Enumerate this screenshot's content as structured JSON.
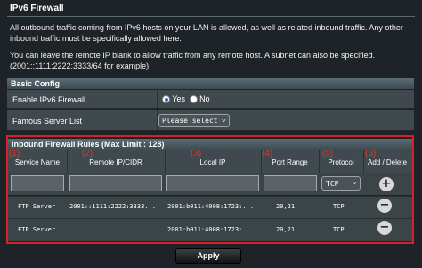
{
  "page": {
    "title": "IPv6 Firewall",
    "description_1": "All outbound traffic coming from IPv6 hosts on your LAN is allowed, as well as related inbound traffic. Any other inbound traffic must be specifically allowed here.",
    "description_2": "You can leave the remote IP blank to allow traffic from any remote host. A subnet can also be specified. (2001::1111:2222:3333/64 for example)"
  },
  "basic_config": {
    "header": "Basic Config",
    "enable_label": "Enable IPv6 Firewall",
    "yes_label": "Yes",
    "no_label": "No",
    "enabled_selected": "Yes",
    "famous_label": "Famous Server List",
    "famous_select": "Please select"
  },
  "inbound": {
    "header": "Inbound Firewall Rules (Max Limit : 128)",
    "numbers": [
      "(1)",
      "(2)",
      "(3)",
      "(4)",
      "(5)",
      "(6)"
    ],
    "columns": [
      "Service Name",
      "Remote IP/CIDR",
      "Local IP",
      "Port Range",
      "Protocol",
      "Add / Delete"
    ],
    "new_protocol": "TCP",
    "rows": [
      {
        "service": "FTP Server",
        "remote": "2001::1111:2222:3333...",
        "local": "2001:b011:4008:1723:...",
        "port": "20,21",
        "protocol": "TCP"
      },
      {
        "service": "FTP Server",
        "remote": "",
        "local": "2001:b011:4008:1723:...",
        "port": "20,21",
        "protocol": "TCP"
      }
    ]
  },
  "buttons": {
    "apply": "Apply",
    "add_symbol": "+",
    "delete_symbol": "−"
  },
  "colors": {
    "highlight": "#d7202a",
    "background": "#1d2326"
  }
}
